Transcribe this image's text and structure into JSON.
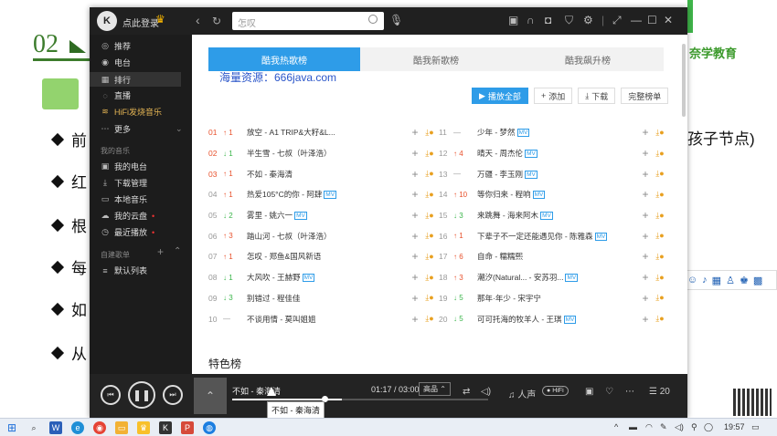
{
  "slide": {
    "number": "02",
    "bullets": [
      "前",
      "红",
      "根",
      "每",
      "如",
      "从"
    ],
    "right_text": "孩子节点)",
    "brand": "奈学教育"
  },
  "ime": {
    "label": "中"
  },
  "app": {
    "titlebar": {
      "login": "点此登录",
      "search_placeholder": "怎叹"
    },
    "sidebar": {
      "items": [
        {
          "icon": "◎",
          "label": "推荐"
        },
        {
          "icon": "◉",
          "label": "电台"
        },
        {
          "icon": "▦",
          "label": "排行"
        },
        {
          "icon": "◌",
          "label": "直播"
        },
        {
          "icon": "≋",
          "label": "HiFi发烧音乐"
        },
        {
          "icon": "⋯",
          "label": "更多"
        }
      ],
      "my_music_header": "我的音乐",
      "my_items": [
        {
          "icon": "▣",
          "label": "我的电台"
        },
        {
          "icon": "⤓",
          "label": "下载管理"
        },
        {
          "icon": "▭",
          "label": "本地音乐"
        },
        {
          "icon": "☁",
          "label": "我的云盘"
        },
        {
          "icon": "◷",
          "label": "最近播放"
        }
      ],
      "created_header": "自建歌单",
      "playlist_items": [
        {
          "icon": "≡",
          "label": "默认列表"
        }
      ]
    },
    "tabs": [
      "酷我热歌榜",
      "酷我新歌榜",
      "酷我飙升榜"
    ],
    "watermark": "海量资源：666java.com",
    "actions": {
      "play_all": "播放全部",
      "add": "添加",
      "download": "下载",
      "full_chart": "完整榜单"
    },
    "songs_left": [
      {
        "rank": "01",
        "trend": "up",
        "delta": "1",
        "title": "放空 - A1 TRIP&大籽&L...",
        "mv": false
      },
      {
        "rank": "02",
        "trend": "down",
        "delta": "1",
        "title": "半生雪 - 七叔（叶泽浩）",
        "mv": false
      },
      {
        "rank": "03",
        "trend": "up",
        "delta": "1",
        "title": "不如 - 秦海清",
        "mv": false
      },
      {
        "rank": "04",
        "trend": "up",
        "delta": "1",
        "title": "热爱105°C的你 - 阿肆",
        "mv": true
      },
      {
        "rank": "05",
        "trend": "down",
        "delta": "2",
        "title": "雾里 - 姚六一",
        "mv": true
      },
      {
        "rank": "06",
        "trend": "up",
        "delta": "3",
        "title": "踏山河 - 七叔（叶泽浩）",
        "mv": false
      },
      {
        "rank": "07",
        "trend": "up",
        "delta": "1",
        "title": "怎叹 - 郑鱼&国风新语",
        "mv": false
      },
      {
        "rank": "08",
        "trend": "down",
        "delta": "1",
        "title": "大风吹 - 王赫野",
        "mv": true
      },
      {
        "rank": "09",
        "trend": "down",
        "delta": "3",
        "title": "别错过 - 程佳佳",
        "mv": false
      },
      {
        "rank": "10",
        "trend": "flat",
        "delta": "",
        "title": "不谈用情 - 莫叫姐姐",
        "mv": false
      }
    ],
    "songs_right": [
      {
        "rank": "11",
        "trend": "flat",
        "delta": "",
        "title": "少年 - 梦然",
        "mv": true
      },
      {
        "rank": "12",
        "trend": "up",
        "delta": "4",
        "title": "晴天 - 周杰伦",
        "mv": true
      },
      {
        "rank": "13",
        "trend": "flat",
        "delta": "",
        "title": "万疆 - 李玉刚",
        "mv": true
      },
      {
        "rank": "14",
        "trend": "up",
        "delta": "10",
        "title": "等你归来 - 程响",
        "mv": true
      },
      {
        "rank": "15",
        "trend": "down",
        "delta": "3",
        "title": "来跳舞 - 海来阿木",
        "mv": true
      },
      {
        "rank": "16",
        "trend": "up",
        "delta": "1",
        "title": "下辈子不一定还能遇见你 - 陈雅森",
        "mv": true
      },
      {
        "rank": "17",
        "trend": "up",
        "delta": "6",
        "title": "自命 - 糯糯熙",
        "mv": false
      },
      {
        "rank": "18",
        "trend": "up",
        "delta": "3",
        "title": "潮汐(Natural... - 安苏羽...",
        "mv": true
      },
      {
        "rank": "19",
        "trend": "down",
        "delta": "5",
        "title": "那年·年少 - 宋宇宁",
        "mv": false
      },
      {
        "rank": "20",
        "trend": "down",
        "delta": "5",
        "title": "可可托海的牧羊人 - 王琪",
        "mv": true
      }
    ],
    "mv_badge": "MV",
    "section_title": "特色榜",
    "player": {
      "now_playing": "不如 - 秦海清",
      "time": "01:17 / 03:00",
      "quality": "高品",
      "voice": "人声",
      "hifi": "HiFi",
      "list_count": "20",
      "progress": 0.43,
      "tooltip": "不如 - 秦海清"
    }
  },
  "taskbar": {
    "clock": "19:57"
  },
  "colors": {
    "accent": "#2e9ce8",
    "up": "#e8512c",
    "down": "#3ab54a"
  }
}
